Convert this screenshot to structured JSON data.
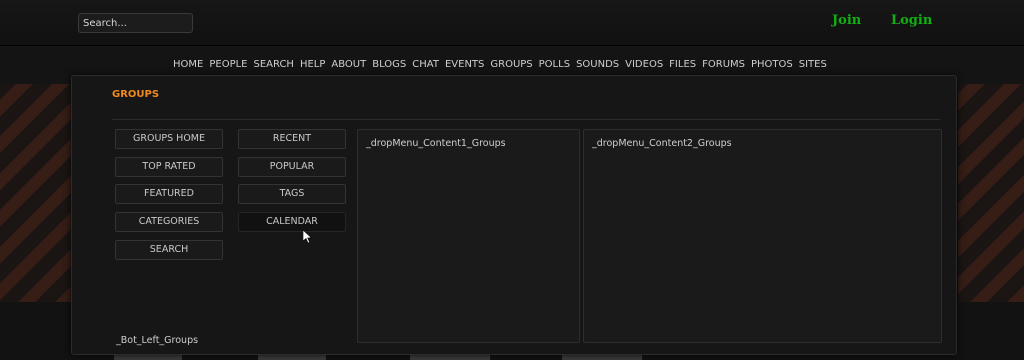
{
  "header": {
    "search_placeholder": "Search...",
    "join_label": "Join",
    "login_label": "Login"
  },
  "nav": {
    "items": [
      "HOME",
      "PEOPLE",
      "SEARCH",
      "HELP",
      "ABOUT",
      "BLOGS",
      "CHAT",
      "EVENTS",
      "GROUPS",
      "POLLS",
      "SOUNDS",
      "VIDEOS",
      "FILES",
      "FORUMS",
      "PHOTOS",
      "SITES"
    ]
  },
  "dropdown": {
    "title": "GROUPS",
    "left_buttons": [
      "GROUPS HOME",
      "TOP RATED",
      "FEATURED",
      "CATEGORIES",
      "SEARCH"
    ],
    "right_buttons": [
      "RECENT",
      "POPULAR",
      "TAGS",
      "CALENDAR"
    ],
    "content1_text": "_dropMenu_Content1_Groups",
    "content2_text": "_dropMenu_Content2_Groups",
    "bot_left_text": "_Bot_Left_Groups"
  },
  "colors": {
    "accent_title": "#f08a1c",
    "auth_link": "#11b011"
  },
  "icons": {
    "cursor": "mouse-pointer-icon"
  }
}
